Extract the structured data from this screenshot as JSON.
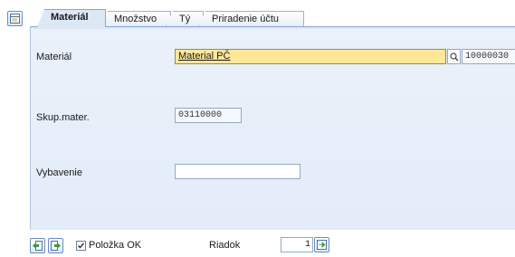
{
  "tabs": [
    {
      "label": "Materiál",
      "active": true
    },
    {
      "label": "Množstvo",
      "active": false
    },
    {
      "label": "Tý",
      "active": false
    },
    {
      "label": "Priradenie účtu",
      "active": false
    }
  ],
  "form": {
    "material_label": "Materiál",
    "material_value": "Material PČ",
    "material_number": "10000030",
    "group_label": "Skup.mater.",
    "group_value": "03110000",
    "vybavenie_label": "Vybavenie",
    "vybavenie_value": ""
  },
  "footer": {
    "item_ok_label": "Položka OK",
    "item_ok_checked": true,
    "row_label": "Riadok",
    "row_value": "1"
  },
  "icons": [
    "layout-toggle-icon",
    "search-icon",
    "previous-item-icon",
    "next-item-icon",
    "checkmark-icon",
    "go-to-row-icon"
  ],
  "colors": {
    "focus_field": "#ffe79a",
    "panel": "#e3ecf8",
    "tab_border": "#8aa6cc"
  }
}
